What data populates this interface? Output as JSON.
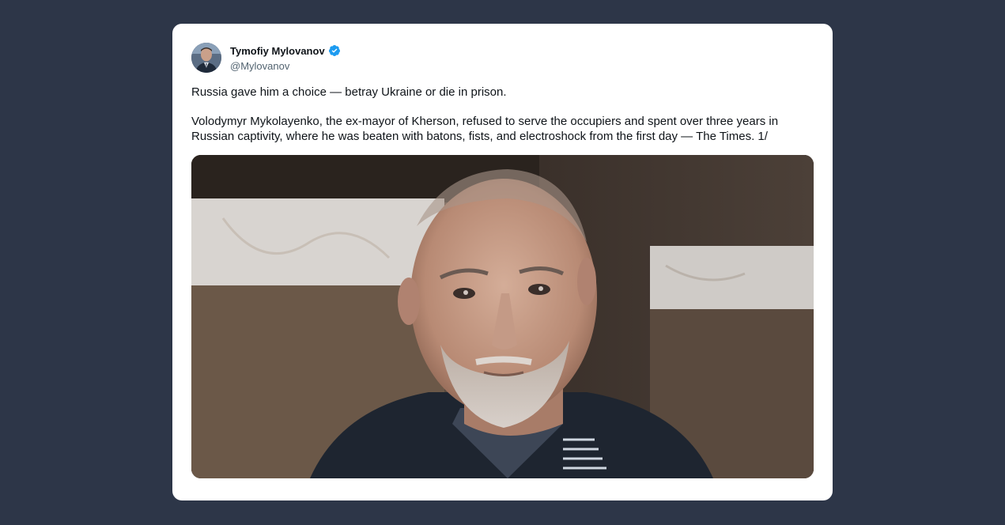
{
  "tweet": {
    "author_name": "Tymofiy Mylovanov",
    "author_handle": "@Mylovanov",
    "verified": true,
    "paragraphs": [
      "Russia gave him a choice — betray Ukraine or die in prison.",
      "Volodymyr Mykolayenko, the ex-mayor of Kherson, refused to serve the occupiers and spent over three years in Russian captivity, where he was beaten with batons, fists, and electroshock from the first day — The Times. 1/"
    ]
  },
  "colors": {
    "page_bg": "#2d3648",
    "card_bg": "#ffffff",
    "verified_badge": "#1d9bf0",
    "text_primary": "#0f1419",
    "text_secondary": "#536471"
  }
}
